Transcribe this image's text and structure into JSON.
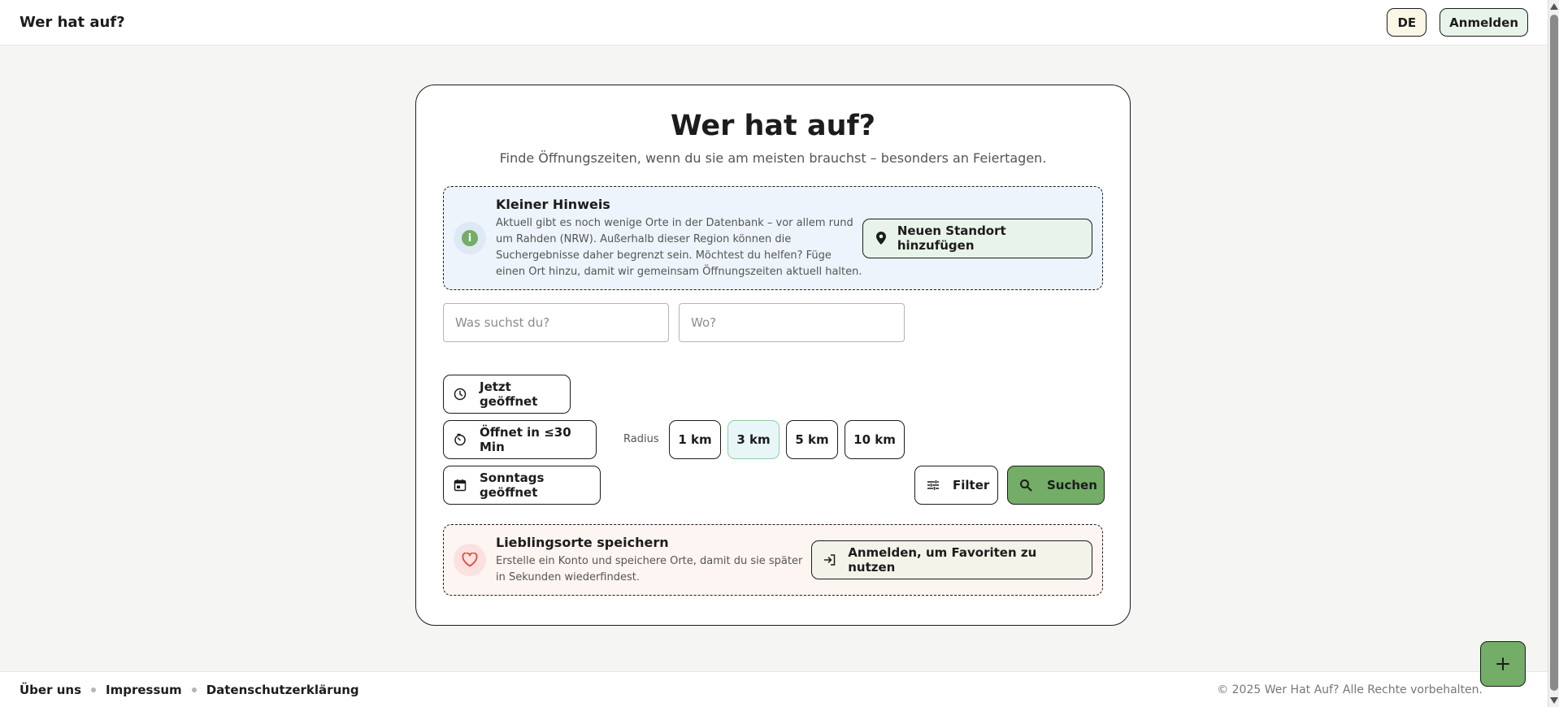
{
  "header": {
    "brand": "Wer hat auf?",
    "language": "DE",
    "login": "Anmelden"
  },
  "hero": {
    "title": "Wer hat auf?",
    "subtitle": "Finde Öffnungszeiten, wenn du sie am meisten brauchst – besonders an Feiertagen."
  },
  "notice": {
    "title": "Kleiner Hinweis",
    "body": "Aktuell gibt es noch wenige Orte in der Datenbank – vor allem rund um Rahden (NRW). Außerhalb dieser Region können die Suchergebnisse daher begrenzt sein. Möchtest du helfen? Füge einen Ort hinzu, damit wir gemeinsam Öffnungszeiten aktuell halten.",
    "button": "Neuen Standort hinzufügen"
  },
  "search": {
    "what_placeholder": "Was suchst du?",
    "where_placeholder": "Wo?",
    "what_value": "",
    "where_value": ""
  },
  "filters": {
    "open_now": "Jetzt geöffnet",
    "opens_soon": "Öffnet in ≤30 Min",
    "sunday": "Sonntags geöffnet",
    "radius_label": "Radius",
    "radius_options": [
      "1 km",
      "3 km",
      "5 km",
      "10 km"
    ],
    "radius_selected": "3 km",
    "filter_button": "Filter",
    "search_button": "Suchen"
  },
  "favorites": {
    "title": "Lieblingsorte speichern",
    "body": "Erstelle ein Konto und speichere Orte, damit du sie später in Sekunden wiederfindest.",
    "button": "Anmelden, um Favoriten zu nutzen"
  },
  "footer": {
    "links": [
      "Über uns",
      "Impressum",
      "Datenschutzerklärung"
    ],
    "copyright": "© 2025 Wer Hat Auf? Alle Rechte vorbehalten."
  },
  "colors": {
    "accent_green": "#73ad67",
    "notice_bg": "#eef4fb",
    "favorites_bg": "#fdf5f1",
    "heart_red": "#e0483e"
  },
  "icons": {
    "notice": "info-icon",
    "add_location": "map-pin-icon",
    "open_now": "clock-icon",
    "opens_soon": "timer-icon",
    "sunday": "calendar-icon",
    "filter": "sliders-icon",
    "search": "search-icon",
    "favorites": "heart-icon",
    "login": "login-icon",
    "fab": "plus-icon"
  }
}
